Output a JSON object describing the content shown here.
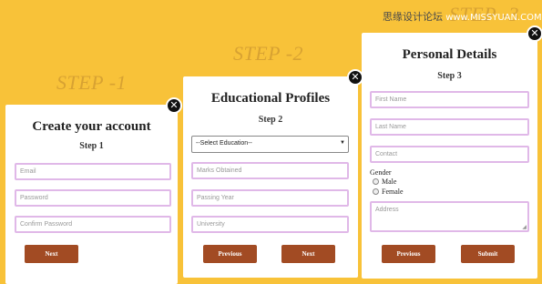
{
  "headings": {
    "step1": "STEP -1",
    "step2": "STEP -2",
    "step3": "STEP -3"
  },
  "watermark": {
    "chinese": "思缘设计论坛",
    "site": "www.MISSYUAN.COM"
  },
  "card1": {
    "title": "Create your account",
    "step": "Step 1",
    "fields": {
      "email": "Email",
      "password": "Password",
      "confirm": "Confirm Password"
    },
    "next": "Next",
    "close": "✕"
  },
  "card2": {
    "title": "Educational Profiles",
    "step": "Step 2",
    "select": "--Select Education--",
    "fields": {
      "marks": "Marks Obtained",
      "year": "Passing Year",
      "university": "University"
    },
    "previous": "Previous",
    "next": "Next",
    "close": "✕"
  },
  "card3": {
    "title": "Personal Details",
    "step": "Step 3",
    "fields": {
      "first": "First Name",
      "last": "Last Name",
      "contact": "Contact",
      "address": "Address"
    },
    "gender_label": "Gender",
    "gender_options": {
      "male": "Male",
      "female": "Female"
    },
    "previous": "Previous",
    "submit": "Submit",
    "close": "✕"
  },
  "colors": {
    "background": "#f8c239",
    "button": "#a24b23",
    "field_border": "#e0b8e8"
  }
}
